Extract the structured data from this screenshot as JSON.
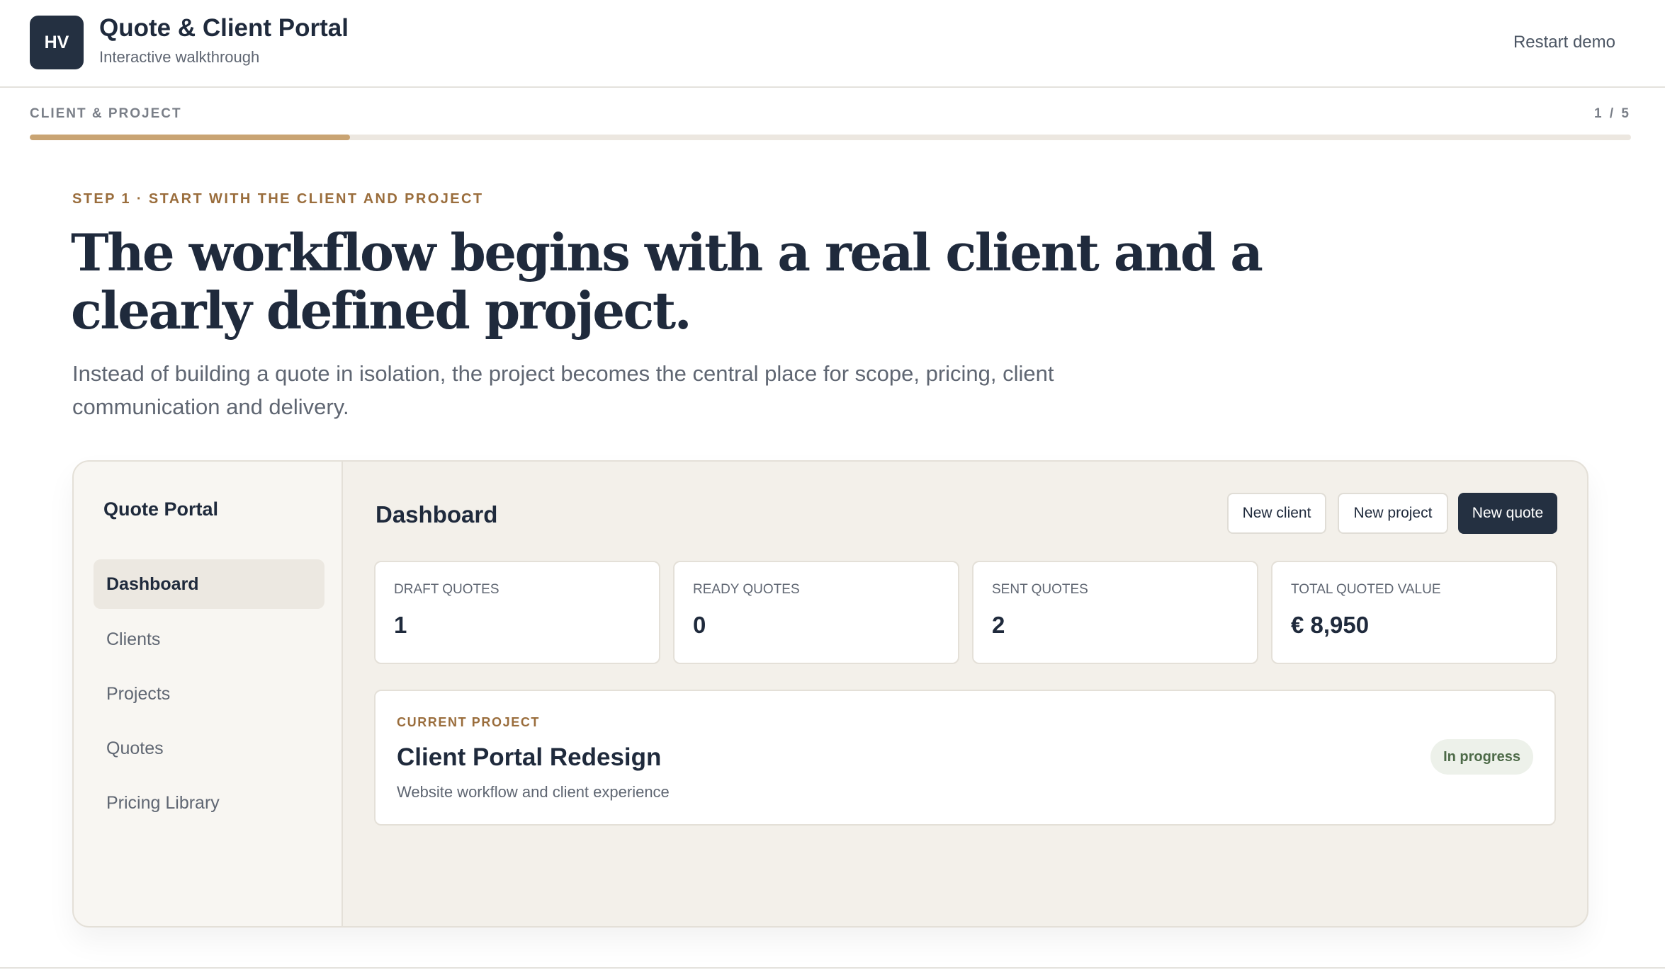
{
  "header": {
    "logo_text": "HV",
    "title": "Quote & Client Portal",
    "subtitle": "Interactive walkthrough",
    "restart_label": "Restart demo"
  },
  "progress": {
    "label": "CLIENT & PROJECT",
    "count": "1 / 5",
    "fraction": 0.2,
    "fill_color": "#c9a473"
  },
  "intro": {
    "step_label": "STEP 1 · START WITH THE CLIENT AND PROJECT",
    "headline": "The workflow begins with a real client and a clearly defined project.",
    "lead": "Instead of building a quote in isolation, the project becomes the central place for scope, pricing, client communication and delivery."
  },
  "portal": {
    "title": "Quote Portal",
    "nav": [
      {
        "label": "Dashboard",
        "active": true
      },
      {
        "label": "Clients",
        "active": false
      },
      {
        "label": "Projects",
        "active": false
      },
      {
        "label": "Quotes",
        "active": false
      },
      {
        "label": "Pricing Library",
        "active": false
      }
    ],
    "dashboard": {
      "title": "Dashboard",
      "buttons": {
        "new_client": "New client",
        "new_project": "New project",
        "new_quote": "New quote"
      },
      "stats": [
        {
          "label": "DRAFT QUOTES",
          "value": "1"
        },
        {
          "label": "READY QUOTES",
          "value": "0"
        },
        {
          "label": "SENT QUOTES",
          "value": "2"
        },
        {
          "label": "TOTAL QUOTED VALUE",
          "value": "€ 8,950"
        }
      ],
      "current_project": {
        "kicker": "CURRENT PROJECT",
        "name": "Client Portal Redesign",
        "description": "Website workflow and client experience",
        "status": "In progress"
      }
    }
  },
  "colors": {
    "primary_dark": "#243041",
    "accent_bronze": "#9a6d3c",
    "status_green": "#4d6a48"
  }
}
